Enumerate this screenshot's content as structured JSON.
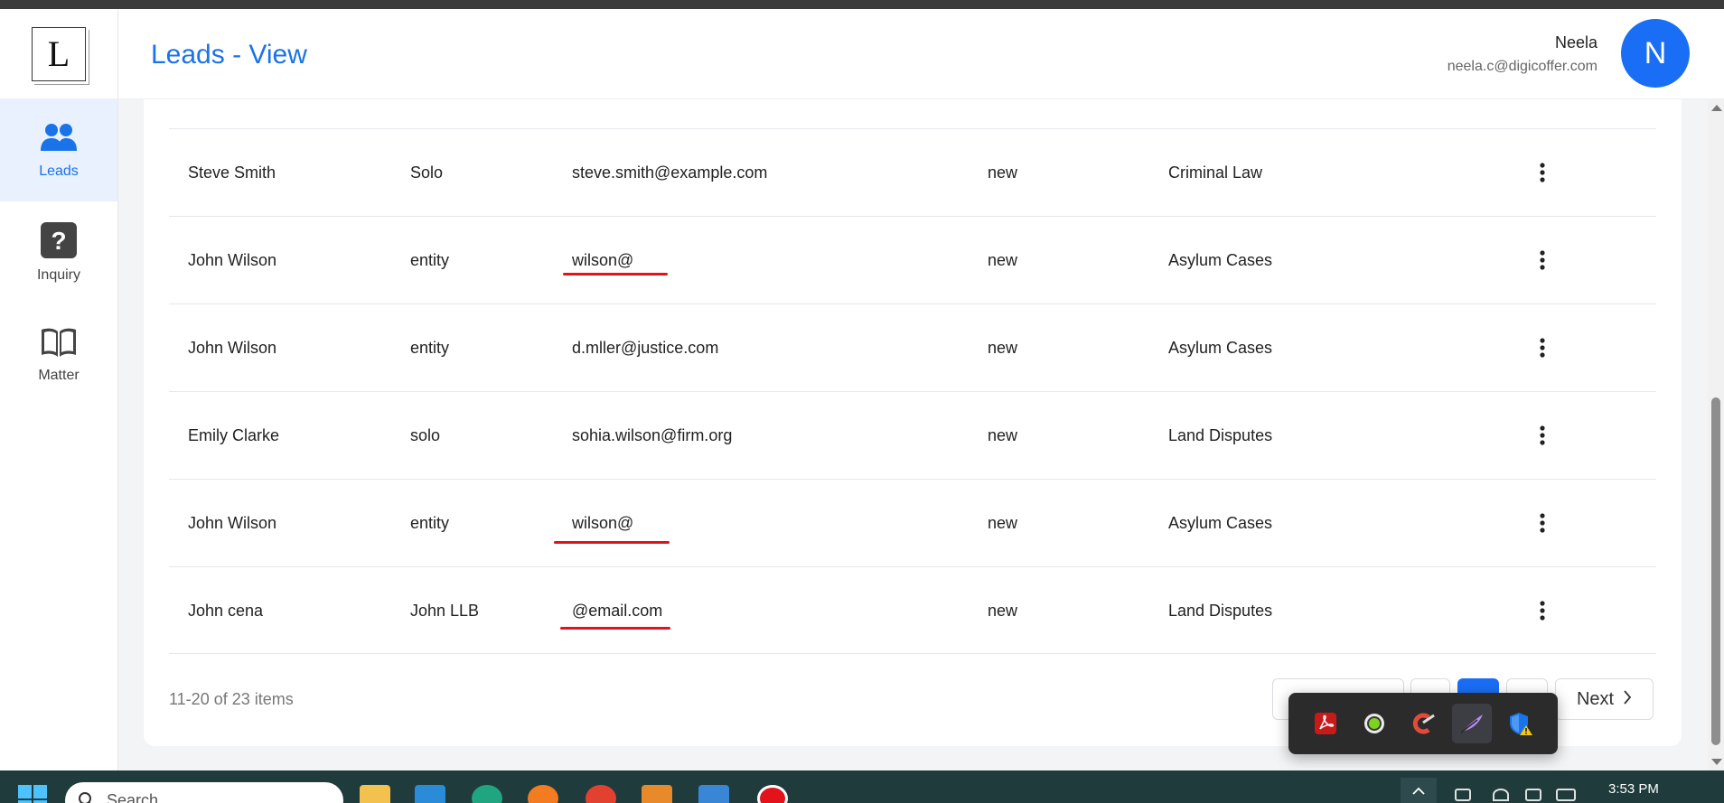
{
  "header": {
    "title": "Leads - View",
    "user_name": "Neela",
    "user_email": "neela.c@digicoffer.com",
    "avatar_initial": "N"
  },
  "logo": {
    "letter": "L"
  },
  "sidebar": {
    "items": [
      {
        "label": "Leads",
        "icon": "users-icon",
        "active": true
      },
      {
        "label": "Inquiry",
        "icon": "question-icon",
        "active": false
      },
      {
        "label": "Matter",
        "icon": "book-icon",
        "active": false
      }
    ]
  },
  "table": {
    "rows": [
      {
        "name": "Steve Smith",
        "type": "Solo",
        "email": "steve.smith@example.com",
        "status": "new",
        "category": "Criminal Law",
        "email_underlined": false
      },
      {
        "name": "John Wilson",
        "type": "entity",
        "email": "wilson@",
        "status": "new",
        "category": "Asylum Cases",
        "email_underlined": true
      },
      {
        "name": "John Wilson",
        "type": "entity",
        "email": "d.mller@justice.com",
        "status": "new",
        "category": "Asylum Cases",
        "email_underlined": false
      },
      {
        "name": "Emily Clarke",
        "type": "solo",
        "email": "sohia.wilson@firm.org",
        "status": "new",
        "category": "Land Disputes",
        "email_underlined": false
      },
      {
        "name": "John Wilson",
        "type": "entity",
        "email": "wilson@",
        "status": "new",
        "category": "Asylum Cases",
        "email_underlined": true
      },
      {
        "name": "John cena",
        "type": "John LLB",
        "email": "@email.com",
        "status": "new",
        "category": "Land Disputes",
        "email_underlined": true
      }
    ]
  },
  "pagination": {
    "summary": "11-20 of 23 items",
    "next_label": "Next",
    "current_page": 2
  },
  "tray_popup": {
    "icons": [
      "acrobat-icon",
      "green-circle-icon",
      "ccleaner-icon",
      "feather-icon",
      "security-shield-icon"
    ]
  },
  "taskbar": {
    "search_placeholder": "Search",
    "clock": "3:53 PM"
  },
  "colors": {
    "accent": "#1a73e8",
    "avatar": "#1a6ef5",
    "underline": "#e3121b"
  }
}
